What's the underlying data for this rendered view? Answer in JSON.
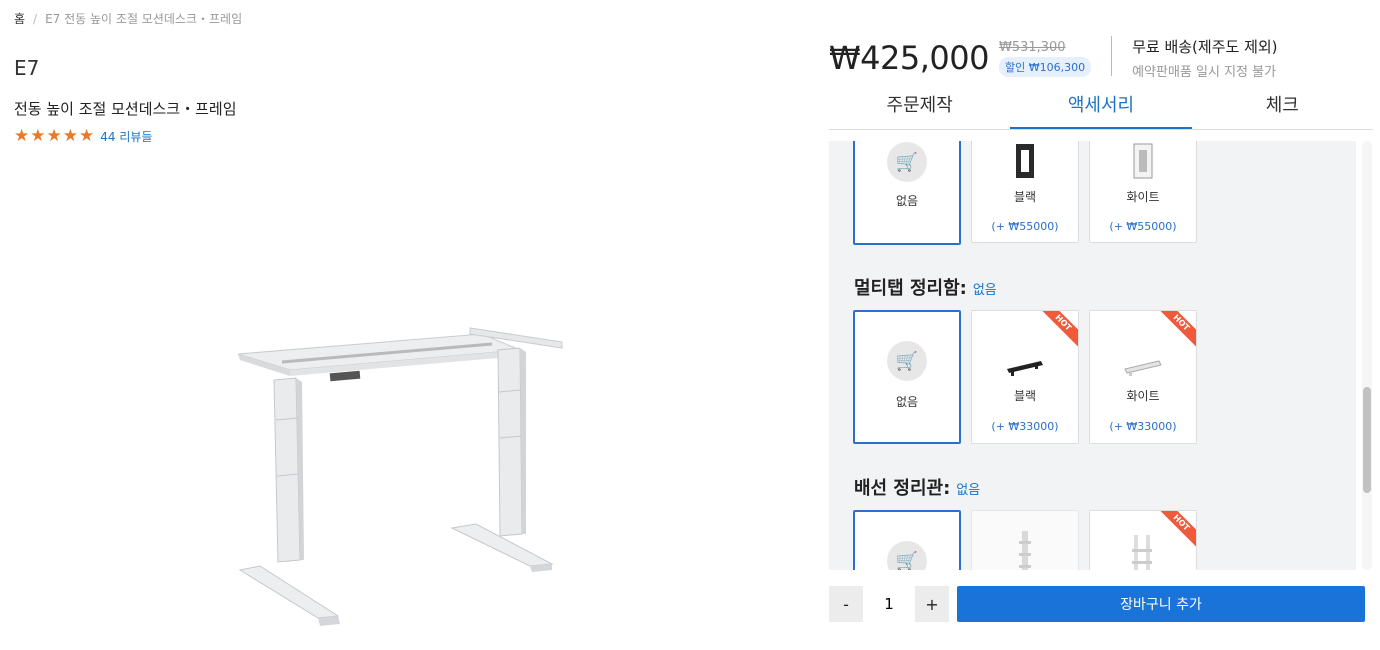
{
  "breadcrumb": {
    "home": "홈",
    "separator": "/",
    "current": "E7 전동 높이 조절 모션데스크・프레임"
  },
  "product": {
    "model": "E7",
    "subtitle": "전동 높이 조절 모션데스크・프레임",
    "rating": 5,
    "reviews_label": "44 리뷰들"
  },
  "pricing": {
    "price": "₩425,000",
    "old_price": "₩531,300",
    "discount": "할인 ₩106,300"
  },
  "shipping": {
    "main": "무료 배송(제주도 제외)",
    "sub": "예약판매품 일시 지정 불가"
  },
  "tabs": [
    {
      "label": "주문제작",
      "active": false
    },
    {
      "label": "액세서리",
      "active": true
    },
    {
      "label": "체크",
      "active": false
    }
  ],
  "sections": {
    "s0": {
      "cards": [
        {
          "name": "없음",
          "selected": true
        },
        {
          "name": "블랙",
          "price": "(+ ₩55000)"
        },
        {
          "name": "화이트",
          "price": "(+ ₩55000)"
        }
      ]
    },
    "s1": {
      "title": "멀티탭 정리함:",
      "selected": "없음",
      "cards": [
        {
          "name": "없음",
          "selected": true
        },
        {
          "name": "블랙",
          "price": "(+ ₩33000)",
          "badge": "HOT"
        },
        {
          "name": "화이트",
          "price": "(+ ₩33000)",
          "badge": "HOT"
        }
      ]
    },
    "s2": {
      "title": "배선 정리관:",
      "selected": "없음",
      "cards": [
        {
          "name": "없음",
          "selected": true
        },
        {
          "name": ""
        },
        {
          "name": "",
          "badge": "HOT"
        }
      ]
    }
  },
  "quantity": {
    "minus": "-",
    "value": "1",
    "plus": "+"
  },
  "cart_button": "장바구니 추가",
  "colors": {
    "accent": "#1a73d8",
    "star": "#e8792a",
    "hot": "#f05a3a"
  }
}
